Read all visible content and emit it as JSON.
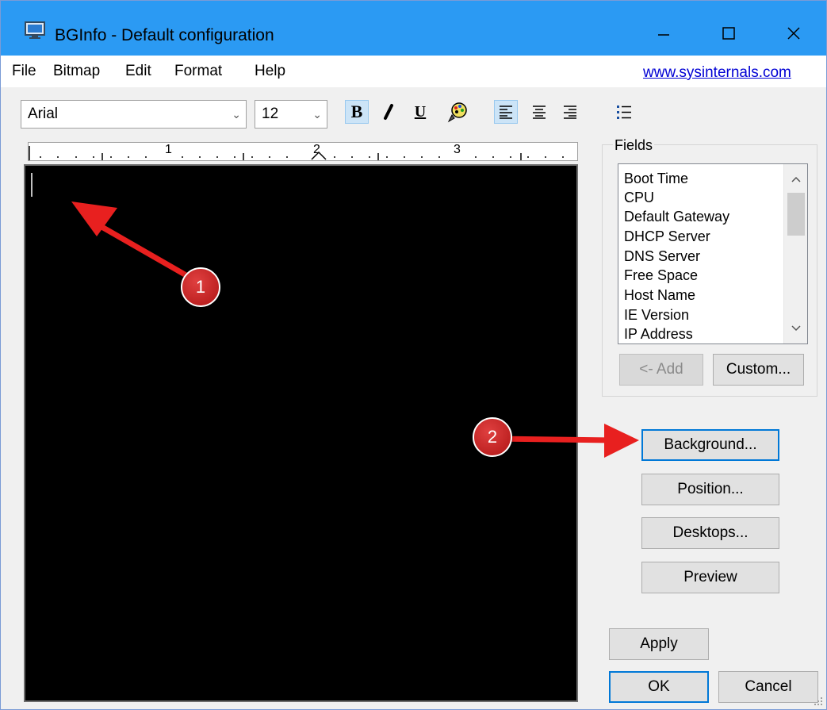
{
  "window": {
    "title": "BGInfo - Default configuration",
    "app_icon": "monitor-icon"
  },
  "titlebar_buttons": {
    "minimize_icon": "minimize-icon",
    "maximize_icon": "maximize-icon",
    "close_icon": "close-icon"
  },
  "menu": {
    "items": [
      "File",
      "Bitmap",
      "Edit",
      "Format",
      "Help"
    ],
    "link": "www.sysinternals.com"
  },
  "toolbar": {
    "font": "Arial",
    "size": "12",
    "bold": "B",
    "underline": "U",
    "italic_icon": "italic-icon",
    "color_icon": "color-picker-icon",
    "align_left_icon": "align-left-icon",
    "align_center_icon": "align-center-icon",
    "align_right_icon": "align-right-icon",
    "bullets_icon": "bullet-list-icon"
  },
  "ruler": {
    "labels": [
      "1",
      "2",
      "3"
    ]
  },
  "fields": {
    "title": "Fields",
    "items": [
      "Boot Time",
      "CPU",
      "Default Gateway",
      "DHCP Server",
      "DNS Server",
      "Free Space",
      "Host Name",
      "IE Version",
      "IP Address"
    ],
    "add_label": "<- Add",
    "custom_label": "Custom..."
  },
  "buttons": {
    "background": "Background...",
    "position": "Position...",
    "desktops": "Desktops...",
    "preview": "Preview",
    "apply": "Apply",
    "ok": "OK",
    "cancel": "Cancel"
  },
  "annotations": {
    "badge1": "1",
    "badge2": "2",
    "arrow_color": "#e8201f"
  },
  "colors": {
    "titlebar": "#2b9af3",
    "editor_background": "#000000",
    "link": "#0000d4"
  }
}
